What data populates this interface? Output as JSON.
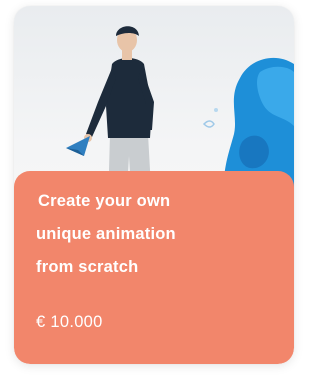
{
  "product": {
    "title_lines": [
      "Create your own",
      "unique animation",
      "from scratch"
    ],
    "price": "€ 10.000"
  },
  "illustration": {
    "icon_name": "person-with-paper-plane-illustration",
    "colors": {
      "panel": "#f2866b",
      "figure_dark": "#1d2b3b",
      "trousers": "#c9cdd0",
      "accent_blue": "#1e8fd8",
      "plane": "#2f7fc0"
    }
  }
}
